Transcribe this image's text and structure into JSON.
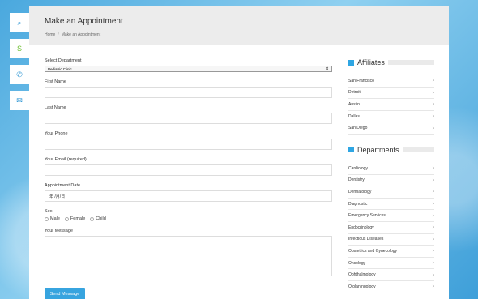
{
  "header": {
    "title": "Make an Appointment",
    "breadcrumbs": [
      "Home",
      "Make an Appointment"
    ]
  },
  "social": {
    "icons": [
      "search-icon",
      "skype-icon",
      "phone-icon",
      "email-icon"
    ]
  },
  "form": {
    "department_label": "Select Department",
    "department_value": "Pediatric Clinic",
    "first_name_label": "First Name",
    "last_name_label": "Last Name",
    "phone_label": "Your Phone",
    "email_label": "Your Email (required)",
    "date_label": "Appointment Date",
    "date_placeholder": "年 /月/日",
    "sex_label": "Sex",
    "sex_options": [
      "Male",
      "Female",
      "Child"
    ],
    "message_label": "Your Message",
    "submit_label": "Send Message"
  },
  "sidebar": {
    "affiliates_title": "Affiliates",
    "affiliates": [
      "San Francisco",
      "Detroit",
      "Austin",
      "Dallas",
      "San Diego"
    ],
    "departments_title": "Departments",
    "departments": [
      "Cardiology",
      "Dentistry",
      "Dermatology",
      "Diagnostic",
      "Emergency Services",
      "Endocrinology",
      "Infectious Diseases",
      "Obstetrics and Gynecology",
      "Oncology",
      "Ophthalmology",
      "Otolaryngology"
    ]
  },
  "colors": {
    "accent": "#37a4df",
    "header_bg": "#ececec"
  }
}
